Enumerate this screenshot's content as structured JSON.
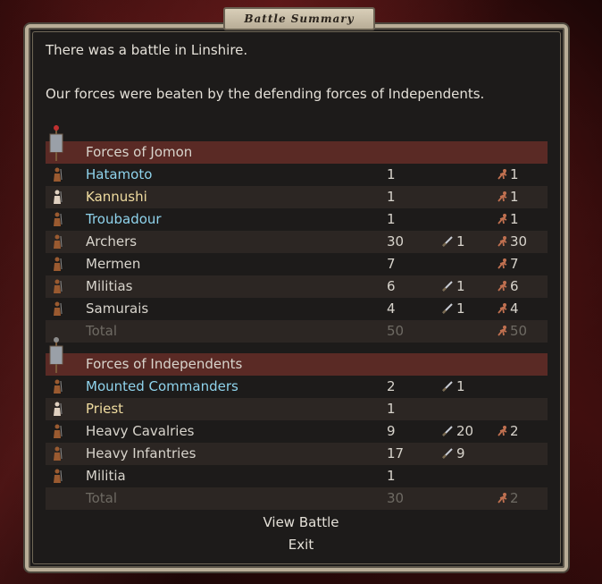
{
  "window": {
    "title": "Battle Summary"
  },
  "messages": {
    "line1": "There was a battle in Linshire.",
    "line2": "Our forces were beaten by the defending forces of Independents."
  },
  "forces": [
    {
      "header": "Forces of Jomon",
      "banner_color": "#c03030",
      "units": [
        {
          "name": "Hatamoto",
          "color": "cyan",
          "count": "1",
          "kills": "",
          "deaths": "1"
        },
        {
          "name": "Kannushi",
          "color": "yellow",
          "count": "1",
          "kills": "",
          "deaths": "1"
        },
        {
          "name": "Troubadour",
          "color": "cyan",
          "count": "1",
          "kills": "",
          "deaths": "1"
        },
        {
          "name": "Archers",
          "color": "",
          "count": "30",
          "kills": "1",
          "deaths": "30"
        },
        {
          "name": "Mermen",
          "color": "",
          "count": "7",
          "kills": "",
          "deaths": "7"
        },
        {
          "name": "Militias",
          "color": "",
          "count": "6",
          "kills": "1",
          "deaths": "6"
        },
        {
          "name": "Samurais",
          "color": "",
          "count": "4",
          "kills": "1",
          "deaths": "4"
        }
      ],
      "total": {
        "label": "Total",
        "count": "50",
        "kills": "",
        "deaths": "50"
      }
    },
    {
      "header": "Forces of Independents",
      "banner_color": "#8c8c8c",
      "units": [
        {
          "name": "Mounted Commanders",
          "color": "cyan",
          "count": "2",
          "kills": "1",
          "deaths": ""
        },
        {
          "name": "Priest",
          "color": "yellow",
          "count": "1",
          "kills": "",
          "deaths": ""
        },
        {
          "name": "Heavy Cavalries",
          "color": "",
          "count": "9",
          "kills": "20",
          "deaths": "2"
        },
        {
          "name": "Heavy Infantries",
          "color": "",
          "count": "17",
          "kills": "9",
          "deaths": ""
        },
        {
          "name": "Militia",
          "color": "",
          "count": "1",
          "kills": "",
          "deaths": ""
        }
      ],
      "total": {
        "label": "Total",
        "count": "30",
        "kills": "",
        "deaths": "2"
      }
    }
  ],
  "actions": {
    "view_battle": "View Battle",
    "exit": "Exit"
  },
  "icons": {
    "sword": "sword-icon",
    "corpse": "casualty-icon",
    "unit": "unit-portrait-icon",
    "banner": "faction-banner-icon"
  },
  "colors": {
    "header_bar": "#5a2a25",
    "hero_name": "#8fd3ec",
    "priest_name": "#f0dca0",
    "total_text": "#6e6a63",
    "frame": "#b9ad97"
  }
}
